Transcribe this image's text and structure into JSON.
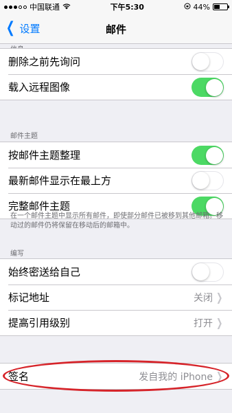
{
  "status": {
    "carrier": "中国联通",
    "time": "下午5:30",
    "battery_text": "44%",
    "battery_level": 0.44
  },
  "nav": {
    "back_label": "设置",
    "title": "邮件"
  },
  "sections": {
    "top_header": "信息",
    "threads_header": "邮件主题",
    "threads_footer": "在一个邮件主题中显示所有邮件，即使部分邮件已被移到其他邮箱。移动过的邮件仍将保留在移动后的邮箱中。",
    "compose_header": "编写"
  },
  "rows": {
    "ask_before_delete": {
      "label": "删除之前先询问",
      "on": false
    },
    "load_remote_images": {
      "label": "载入远程图像",
      "on": true
    },
    "organize_by_thread": {
      "label": "按邮件主题整理",
      "on": true
    },
    "most_recent_on_top": {
      "label": "最新邮件显示在最上方",
      "on": false
    },
    "complete_threads": {
      "label": "完整邮件主题",
      "on": true
    },
    "always_bcc_myself": {
      "label": "始终密送给自己",
      "on": false
    },
    "mark_addresses": {
      "label": "标记地址",
      "value": "关闭"
    },
    "increase_quote_level": {
      "label": "提高引用级别",
      "value": "打开"
    },
    "signature": {
      "label": "签名",
      "value": "发自我的 iPhone"
    }
  },
  "colors": {
    "accent": "#007aff",
    "toggle_on": "#4cd964",
    "highlight": "#d6242a"
  }
}
